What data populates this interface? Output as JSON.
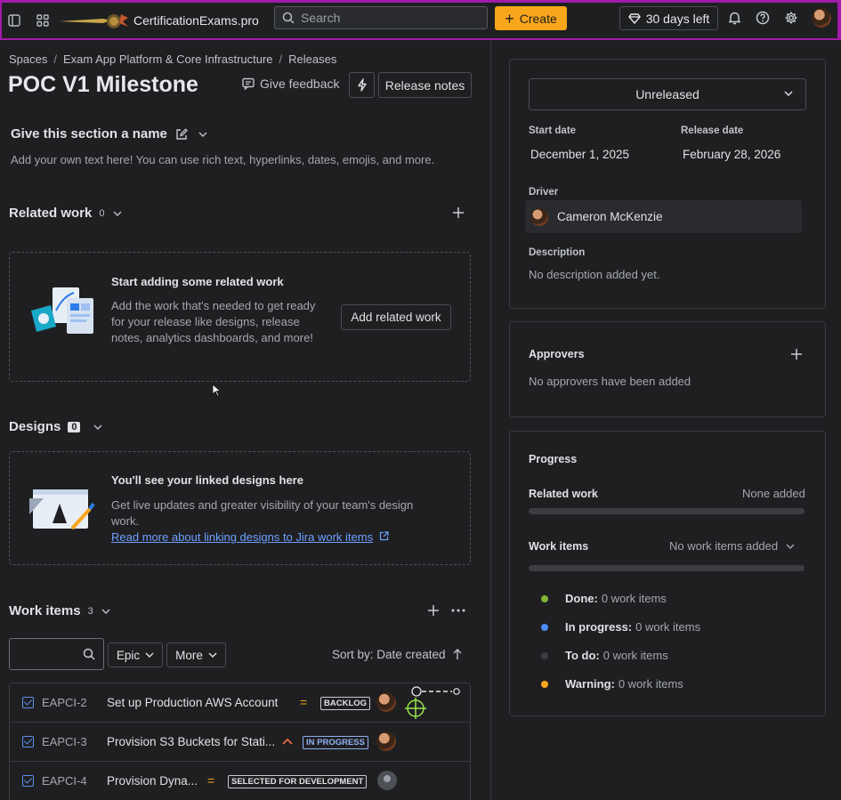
{
  "topbar": {
    "brand": "CertificationExams.pro",
    "search_placeholder": "Search",
    "create_label": "Create",
    "trial_label": "30 days left"
  },
  "breadcrumbs": [
    "Spaces",
    "Exam App Platform & Core Infrastructure",
    "Releases"
  ],
  "page": {
    "title": "POC V1 Milestone",
    "feedback_label": "Give feedback",
    "release_notes_label": "Release notes"
  },
  "section_name": {
    "title": "Give this section a name",
    "description": "Add your own text here! You can use rich text, hyperlinks, dates, emojis, and more."
  },
  "related_work": {
    "title": "Related work",
    "count": "0",
    "empty_title": "Start adding some related work",
    "empty_body": "Add the work that's needed to get ready for your release like designs, release notes, analytics dashboards, and more!",
    "add_button": "Add related work"
  },
  "designs": {
    "title": "Designs",
    "count": "0",
    "empty_title": "You'll see your linked designs here",
    "empty_body": "Get live updates and greater visibility of your team's design work.",
    "link": "Read more about linking designs to Jira work items"
  },
  "work_items": {
    "title": "Work items",
    "count": "3",
    "filter_epic": "Epic",
    "filter_more": "More",
    "sort_label": "Sort by: Date created",
    "rows": [
      {
        "key": "EAPCI-2",
        "summary": "Set up Production AWS Account",
        "priority": "medium",
        "status": "BACKLOG",
        "assignee": "photo"
      },
      {
        "key": "EAPCI-3",
        "summary": "Provision S3 Buckets for Stati...",
        "priority": "high",
        "status": "IN PROGRESS",
        "assignee": "photo"
      },
      {
        "key": "EAPCI-4",
        "summary": "Provision Dyna...",
        "priority": "medium",
        "status": "SELECTED FOR DEVELOPMENT",
        "assignee": "unassigned"
      }
    ]
  },
  "details": {
    "status": "Unreleased",
    "start_date_label": "Start date",
    "start_date": "December 1, 2025",
    "release_date_label": "Release date",
    "release_date": "February 28, 2026",
    "driver_label": "Driver",
    "driver_name": "Cameron McKenzie",
    "description_label": "Description",
    "description": "No description added yet."
  },
  "approvers": {
    "title": "Approvers",
    "empty": "No approvers have been added"
  },
  "progress": {
    "title": "Progress",
    "related_work_label": "Related work",
    "related_work_value": "None added",
    "work_items_label": "Work items",
    "work_items_value": "No work items added",
    "legend": [
      {
        "label": "Done:",
        "value": "0 work items",
        "color": "#82b536"
      },
      {
        "label": "In progress:",
        "value": "0 work items",
        "color": "#4c8bf5"
      },
      {
        "label": "To do:",
        "value": "0 work items",
        "color": "#3b3d42"
      },
      {
        "label": "Warning:",
        "value": "0 work items",
        "color": "#f8a61c"
      }
    ]
  },
  "colors": {
    "accent_border": "#a11aa8",
    "create_button": "#f8a61c",
    "background": "#1f1f21",
    "link": "#6ea0ff"
  }
}
